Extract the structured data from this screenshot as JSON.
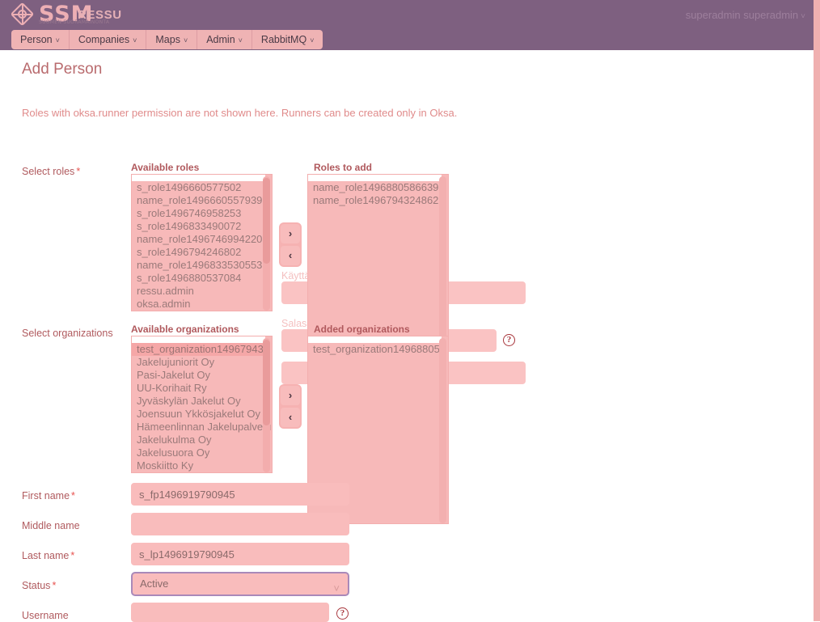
{
  "topbar": {
    "logo_text": "SSM",
    "logo_subtitle": "SUOMEN SUORAMAINONTA",
    "app_name": "RESSU",
    "user_menu": "superadmin superadmin",
    "user_caret": "chevron-down-icon",
    "nav": [
      {
        "label": "Person",
        "caret": "˅"
      },
      {
        "label": "Companies",
        "caret": "˅"
      },
      {
        "label": "Maps",
        "caret": "˅"
      },
      {
        "label": "Admin",
        "caret": "˅"
      },
      {
        "label": "RabbitMQ",
        "caret": "˅"
      }
    ]
  },
  "page": {
    "title": "Add Person",
    "notice": "Roles with oksa.runner permission are not shown here. Runners can be created only in Oksa."
  },
  "roles": {
    "row_label": "Select roles",
    "required_mark": "*",
    "available_caption": "Available roles",
    "added_caption": "Roles to add",
    "available": [
      "s_role1496660577502",
      "name_role1496660557939",
      "s_role1496746958253",
      "s_role1496833490072",
      "name_role1496746994220",
      "s_role1496794246802",
      "name_role1496833530553",
      "s_role1496880537084",
      "ressu.admin",
      "oksa.admin"
    ],
    "added": [
      "name_role1496880586639",
      "name_role1496794324862"
    ],
    "add_button": "›",
    "remove_button": "‹"
  },
  "organizations": {
    "row_label": "Select organizations",
    "available_caption": "Available organizations",
    "added_caption": "Added organizations",
    "available": [
      "test_organization14967943:",
      "Jakelujuniorit Oy",
      "Pasi-Jakelut Oy",
      "UU-Korihait Ry",
      "Jyväskylän Jakelut Oy",
      "Joensuun Ykkösjakelut Oy",
      "Hämeenlinnan Jakelupalvelu",
      "Jakelukulma Oy",
      "Jakelusuora Oy",
      "Moskiitto Ky"
    ],
    "added": [
      "test_organization14968805 "
    ],
    "add_button": "›",
    "remove_button": "‹"
  },
  "hidden_fields": {
    "username_fi_label": "Käyttä",
    "password_fi_label": "Salasana",
    "required_mark": "*"
  },
  "form": {
    "first_name": {
      "label": "First name",
      "required": "*",
      "value": "s_fp1496919790945"
    },
    "middle_name": {
      "label": "Middle name",
      "required": "",
      "value": ""
    },
    "last_name": {
      "label": "Last name",
      "required": "*",
      "value": "s_lp1496919790945"
    },
    "status": {
      "label": "Status",
      "required": "*",
      "value": "Active",
      "caret": "˅"
    },
    "username": {
      "label": "Username",
      "required": "",
      "value": "",
      "help": "?"
    }
  },
  "colors": {
    "topbar": "#7e6080",
    "nav_pill": "#efb3b4",
    "field_pink": "#f9bcbc",
    "list_pink": "#f7b9b9",
    "accent_text": "#b05a5e",
    "notice_text": "#e08b8b",
    "focus_border": "#a989b9",
    "help_icon": "#a8363c"
  }
}
